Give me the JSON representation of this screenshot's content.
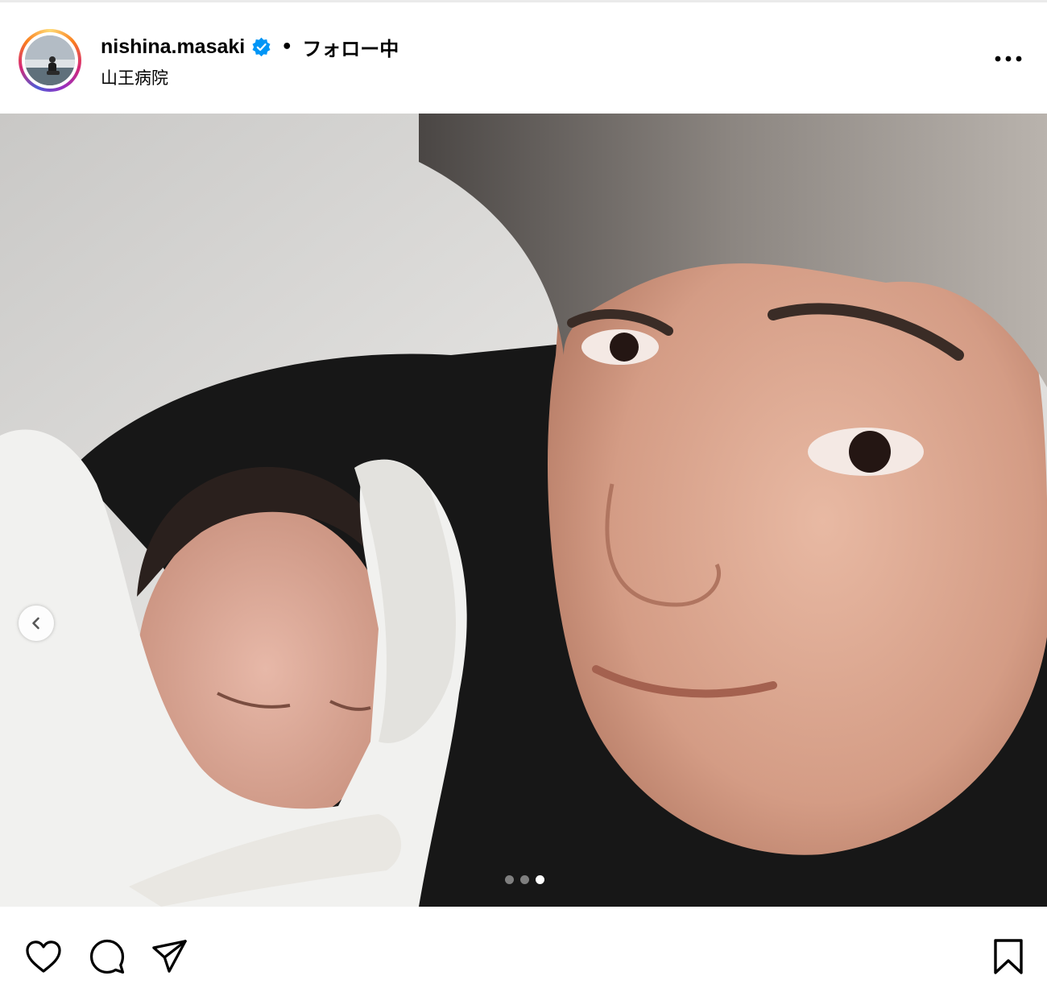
{
  "header": {
    "username": "nishina.masaki",
    "separator": "•",
    "follow_status": "フォロー中",
    "location": "山王病院"
  },
  "icons": {
    "verified": "verified-badge-icon",
    "more": "more-options-icon",
    "prev": "chevron-left-icon",
    "like": "heart-icon",
    "comment": "comment-icon",
    "share": "send-icon",
    "save": "bookmark-icon"
  },
  "carousel": {
    "total_slides": 3,
    "active_slide": 3
  },
  "colors": {
    "verified_blue": "#0095f6",
    "text": "#000000",
    "background": "#ffffff"
  }
}
